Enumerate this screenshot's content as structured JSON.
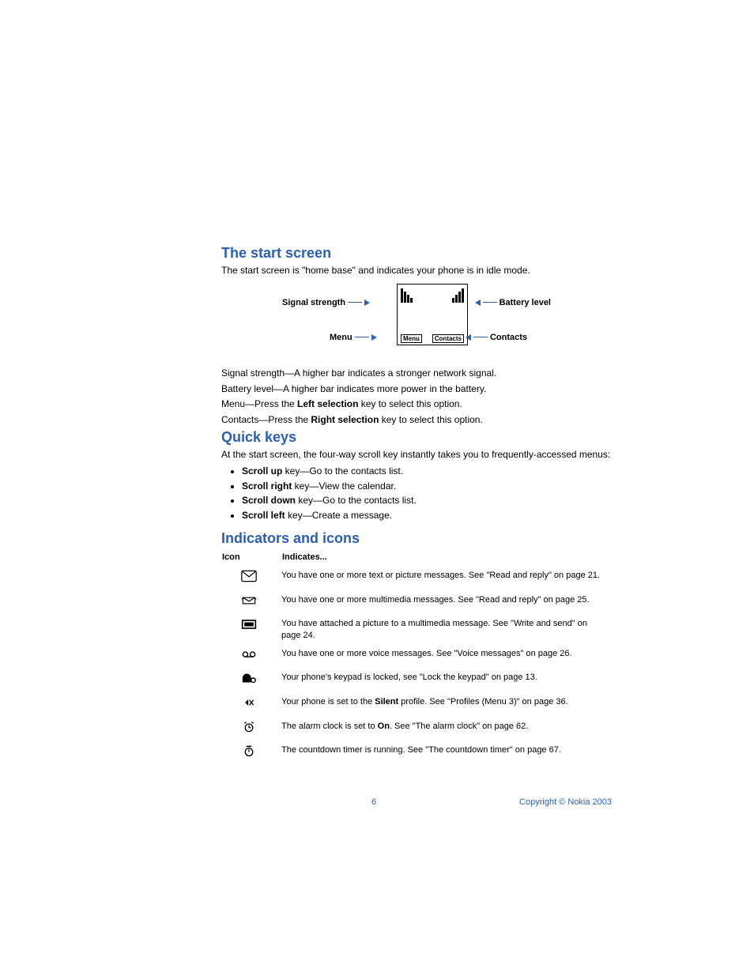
{
  "sections": {
    "start": {
      "heading": "The start screen",
      "intro": "The start screen is \"home base\" and indicates your phone is in idle mode.",
      "labels": {
        "signal": "Signal strength",
        "battery": "Battery level",
        "menu": "Menu",
        "contacts": "Contacts",
        "screen_menu": "Menu",
        "screen_contacts": "Contacts"
      },
      "lines": {
        "signal": "Signal strength—A higher bar indicates a stronger network signal.",
        "battery": "Battery level—A higher bar indicates more power in the battery.",
        "menu_pre": "Menu—Press the ",
        "menu_bold": "Left selection",
        "menu_post": " key to select this option.",
        "contacts_pre": "Contacts—Press the ",
        "contacts_bold": "Right selection",
        "contacts_post": " key to select this option."
      }
    },
    "quick": {
      "heading": "Quick keys",
      "intro": "At the start screen, the four-way scroll key instantly takes you to frequently-accessed menus:",
      "items": {
        "up_bold": "Scroll up",
        "up_rest": " key—Go to the contacts list.",
        "right_bold": "Scroll right",
        "right_rest": " key—View the calendar.",
        "down_bold": "Scroll down",
        "down_rest": " key—Go to the contacts list.",
        "left_bold": "Scroll left",
        "left_rest": " key—Create a message."
      }
    },
    "icons": {
      "heading": "Indicators and icons",
      "th_icon": "Icon",
      "th_ind": "Indicates...",
      "rows": {
        "r1": "You have one or more text or picture messages. See \"Read and reply\" on page 21.",
        "r2": "You have one or more multimedia messages. See \"Read and reply\" on page 25.",
        "r3": "You have attached a picture to a multimedia message. See \"Write and send\" on page 24.",
        "r4": "You have one or more voice messages. See \"Voice messages\" on page 26.",
        "r5": "Your phone's keypad is locked, see \"Lock the keypad\" on page 13.",
        "r6_pre": "Your phone is set to the ",
        "r6_bold": "Silent",
        "r6_post": " profile. See \"Profiles (Menu 3)\" on page 36.",
        "r7_pre": "The alarm clock is set to ",
        "r7_bold": "On",
        "r7_post": ". See \"The alarm clock\" on page 62.",
        "r8": "The countdown timer is running. See \"The countdown timer\" on page 67."
      }
    }
  },
  "footer": {
    "page": "6",
    "copyright": "Copyright © Nokia 2003"
  }
}
